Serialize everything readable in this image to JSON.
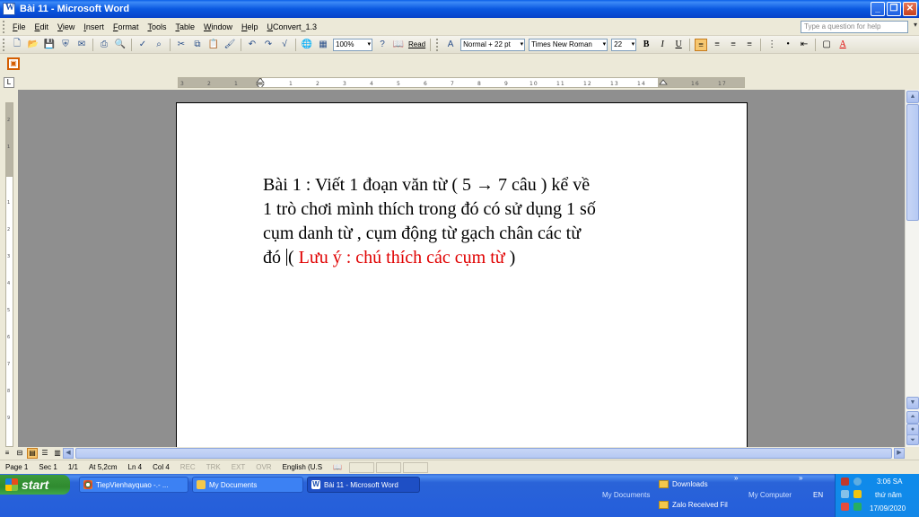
{
  "window": {
    "title": "Bài 11 - Microsoft Word"
  },
  "menu": {
    "items": [
      "File",
      "Edit",
      "View",
      "Insert",
      "Format",
      "Tools",
      "Table",
      "Window",
      "Help",
      "UConvert_1.3"
    ],
    "help_placeholder": "Type a question for help"
  },
  "toolbar": {
    "zoom": "100%",
    "read_label": "Read",
    "style": "Normal + 22 pt",
    "font": "Times New Roman",
    "size": "22",
    "bold": "B",
    "italic": "I",
    "underline": "U"
  },
  "ruler": {
    "corner": "L"
  },
  "document": {
    "line1": "Bài 1 : Viết 1 đoạn văn từ ( 5 ",
    "arrow": "→",
    "line1b": " 7 câu ) kể về",
    "line2": "1 trò chơi mình thích trong đó có sử dụng 1 số",
    "line3": "cụm danh từ , cụm động từ gạch chân các từ",
    "line4a": "đó ",
    "line4b": "( ",
    "note": "Lưu ý : chú thích các cụm từ",
    "line4c": " )"
  },
  "status": {
    "page": "Page  1",
    "sec": "Sec  1",
    "pages": "1/1",
    "at": "At  5,2cm",
    "ln": "Ln  4",
    "col": "Col  4",
    "rec": "REC",
    "trk": "TRK",
    "ext": "EXT",
    "ovr": "OVR",
    "lang": "English (U.S"
  },
  "taskbar": {
    "start": "start",
    "tasks": [
      "TiepVienhayquao -.- ...",
      "My Documents",
      "Bài 11 - Microsoft Word"
    ],
    "my_documents": "My Documents",
    "my_computer": "My Computer",
    "downloads": "Downloads",
    "zalo": "Zalo Received Fil",
    "lang": "EN",
    "time": "3:06 SA",
    "day": "thứ năm",
    "date": "17/09/2020"
  }
}
